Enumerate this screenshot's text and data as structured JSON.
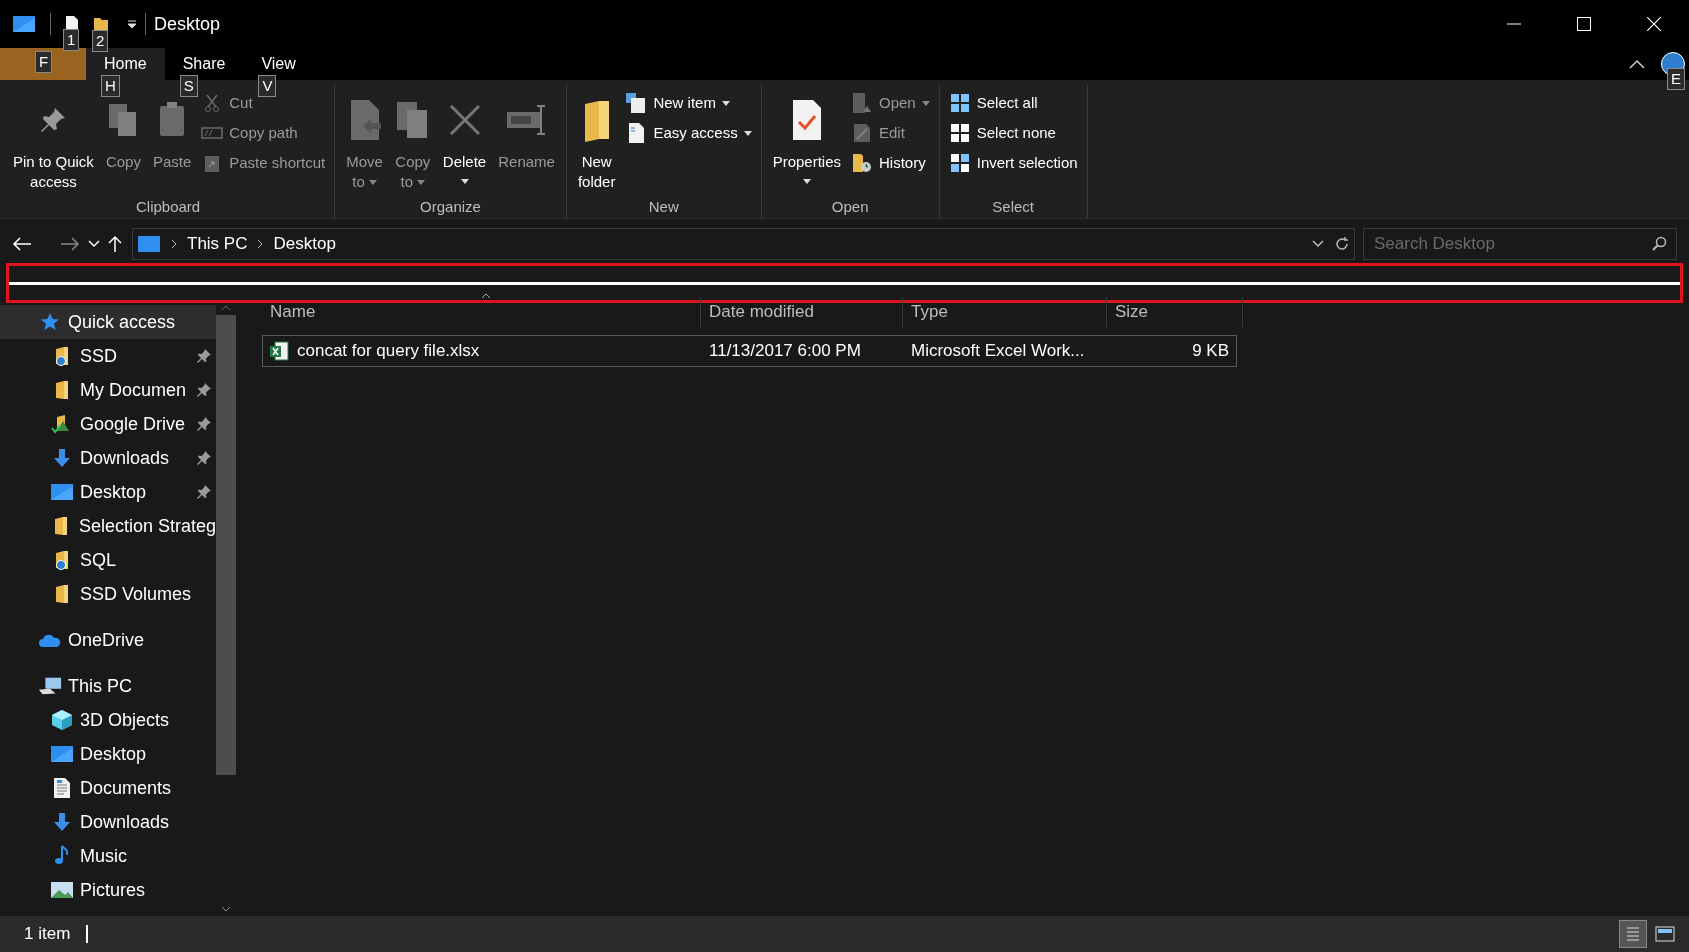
{
  "title_bar": {
    "qat_keytips": [
      "1",
      "2"
    ],
    "title": "Desktop"
  },
  "ribbon_tabs": [
    {
      "kind": "file",
      "keytip": "F",
      "selected": false
    },
    {
      "kind": "tab",
      "label": "Home",
      "keytip": "H",
      "selected": true
    },
    {
      "kind": "tab",
      "label": "Share",
      "keytip": "S",
      "selected": false
    },
    {
      "kind": "tab",
      "label": "View",
      "keytip": "V",
      "selected": false
    }
  ],
  "help_keytip": "E",
  "ribbon_groups": [
    {
      "label": "Clipboard",
      "large": [
        {
          "kind": "pin",
          "lines": [
            "Pin to Quick",
            "access"
          ],
          "disabled": false,
          "dropdown": false
        },
        {
          "kind": "copy",
          "lines": [
            "Copy"
          ],
          "disabled": true,
          "dropdown": false
        },
        {
          "kind": "paste",
          "lines": [
            "Paste"
          ],
          "disabled": true,
          "dropdown": false
        }
      ],
      "small": [
        {
          "kind": "cut",
          "lines": [
            "Cut"
          ],
          "disabled": true,
          "dropdown": false
        },
        {
          "kind": "copypath",
          "lines": [
            "Copy path"
          ],
          "disabled": true,
          "dropdown": false
        },
        {
          "kind": "shortcut",
          "lines": [
            "Paste shortcut"
          ],
          "disabled": true,
          "dropdown": false
        }
      ]
    },
    {
      "label": "Organize",
      "large": [
        {
          "kind": "move",
          "lines": [
            "Move",
            "to"
          ],
          "disabled": true,
          "dropdown": true
        },
        {
          "kind": "copyto",
          "lines": [
            "Copy",
            "to"
          ],
          "disabled": true,
          "dropdown": true
        },
        {
          "kind": "delete",
          "lines": [
            "Delete"
          ],
          "disabled": false,
          "dropdown": true
        },
        {
          "kind": "rename",
          "lines": [
            "Rename"
          ],
          "disabled": true,
          "dropdown": false
        }
      ]
    },
    {
      "label": "New",
      "large": [
        {
          "kind": "newfolder",
          "lines": [
            "New",
            "folder"
          ],
          "disabled": false,
          "dropdown": false
        }
      ],
      "small": [
        {
          "kind": "newitem",
          "lines": [
            "New item"
          ],
          "disabled": false,
          "dropdown": true
        },
        {
          "kind": "easyaccess",
          "lines": [
            "Easy access"
          ],
          "disabled": false,
          "dropdown": true
        }
      ]
    },
    {
      "label": "Open",
      "large": [
        {
          "kind": "properties",
          "lines": [
            "Properties"
          ],
          "disabled": false,
          "dropdown": true
        }
      ],
      "small": [
        {
          "kind": "open",
          "lines": [
            "Open"
          ],
          "disabled": true,
          "dropdown": true
        },
        {
          "kind": "edit",
          "lines": [
            "Edit"
          ],
          "disabled": true,
          "dropdown": false
        },
        {
          "kind": "history",
          "lines": [
            "History"
          ],
          "disabled": false,
          "dropdown": false
        }
      ]
    },
    {
      "label": "Select",
      "small": [
        {
          "kind": "selectall",
          "lines": [
            "Select all"
          ],
          "disabled": false,
          "dropdown": false
        },
        {
          "kind": "selectnone",
          "lines": [
            "Select none"
          ],
          "disabled": false,
          "dropdown": false
        },
        {
          "kind": "invert",
          "lines": [
            "Invert selection"
          ],
          "disabled": false,
          "dropdown": false
        }
      ]
    }
  ],
  "address_bar": {
    "breadcrumbs": [
      "This PC",
      "Desktop"
    ],
    "search": {
      "placeholder": "Search Desktop"
    }
  },
  "sidebar": {
    "items": [
      {
        "kind": "star",
        "label": "Quick access",
        "selected": true,
        "children": [
          {
            "kind": "starfolder",
            "label": "SSD",
            "pinned": true,
            "selected": false
          },
          {
            "kind": "folder",
            "label": "My Documen",
            "pinned": true,
            "selected": false
          },
          {
            "kind": "drivefolder",
            "label": "Google Drive",
            "pinned": true,
            "selected": false
          },
          {
            "kind": "downloads",
            "label": "Downloads",
            "pinned": true,
            "selected": false
          },
          {
            "kind": "desktop",
            "label": "Desktop",
            "pinned": true,
            "selected": false
          },
          {
            "kind": "folder",
            "label": "Selection Strateg",
            "pinned": false,
            "selected": false
          },
          {
            "kind": "starfolder",
            "label": "SQL",
            "pinned": false,
            "selected": false
          },
          {
            "kind": "folder",
            "label": "SSD Volumes",
            "pinned": false,
            "selected": false
          }
        ]
      },
      {
        "kind": "onedrive",
        "label": "OneDrive",
        "selected": false
      },
      {
        "kind": "pc",
        "label": "This PC",
        "selected": false,
        "children": [
          {
            "kind": "cube",
            "label": "3D Objects",
            "pinned": false,
            "selected": false
          },
          {
            "kind": "desktop",
            "label": "Desktop",
            "pinned": false,
            "selected": false
          },
          {
            "kind": "documents",
            "label": "Documents",
            "pinned": false,
            "selected": false
          },
          {
            "kind": "downloads",
            "label": "Downloads",
            "pinned": false,
            "selected": false
          },
          {
            "kind": "music",
            "label": "Music",
            "pinned": false,
            "selected": false
          },
          {
            "kind": "pictures",
            "label": "Pictures",
            "pinned": false,
            "selected": false
          }
        ]
      }
    ]
  },
  "file_list": {
    "columns": [
      {
        "label": "Name",
        "sorted": true
      },
      {
        "label": "Date modified",
        "sorted": false
      },
      {
        "label": "Type",
        "sorted": false
      },
      {
        "label": "Size",
        "sorted": false
      }
    ],
    "rows": [
      {
        "name": "concat for query file.xlsx",
        "date_modified": "11/13/2017 6:00 PM",
        "type": "Microsoft Excel Work...",
        "size": "9 KB",
        "focused": true
      }
    ]
  },
  "status_bar": {
    "count": "1 item",
    "views": [
      {
        "kind": "details",
        "selected": true
      },
      {
        "kind": "tiles",
        "selected": false
      }
    ]
  }
}
